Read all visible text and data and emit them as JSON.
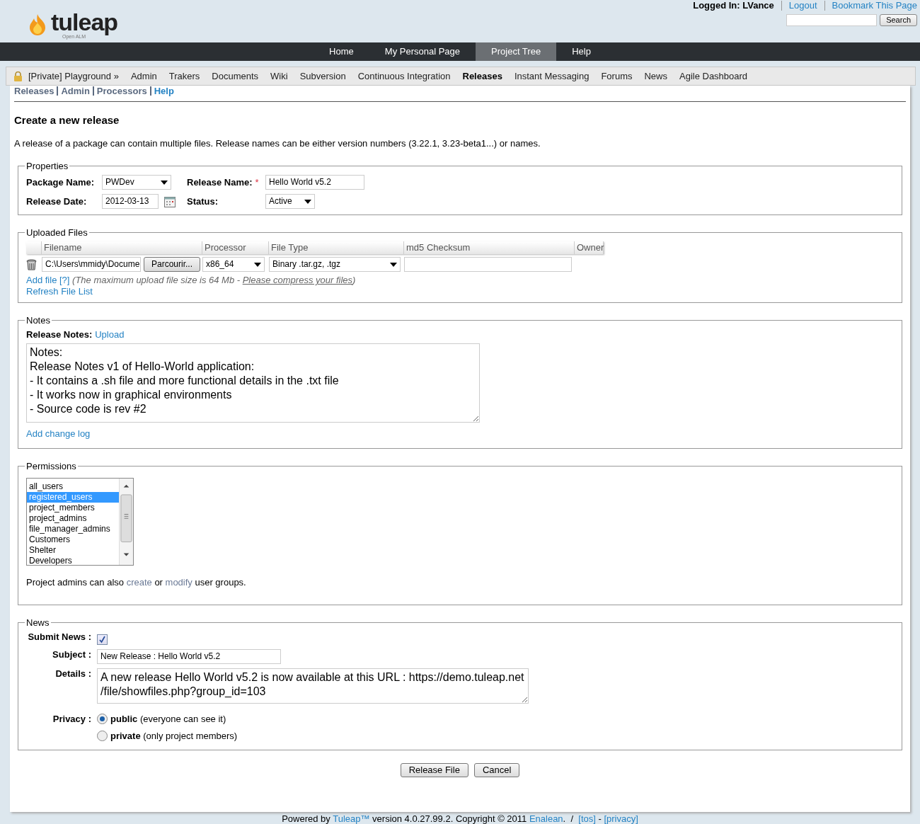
{
  "header": {
    "logo": {
      "name": "tuleap",
      "tagline": "Open ALM"
    },
    "logged_in": "Logged In: LVance",
    "links": [
      "Logout",
      "Bookmark This Page"
    ],
    "search": {
      "button": "Search"
    }
  },
  "main_nav": [
    {
      "label": "Home",
      "selected": false
    },
    {
      "label": "My Personal Page",
      "selected": false
    },
    {
      "label": "Project Tree",
      "selected": true
    },
    {
      "label": "Help",
      "selected": false
    }
  ],
  "project_nav": {
    "project": "[Private] Playground »",
    "items": [
      {
        "label": "Admin",
        "selected": false
      },
      {
        "label": "Trakers",
        "selected": false
      },
      {
        "label": "Documents",
        "selected": false
      },
      {
        "label": "Wiki",
        "selected": false
      },
      {
        "label": "Subversion",
        "selected": false
      },
      {
        "label": "Continuous Integration",
        "selected": false
      },
      {
        "label": "Releases",
        "selected": true
      },
      {
        "label": "Instant Messaging",
        "selected": false
      },
      {
        "label": "Forums",
        "selected": false
      },
      {
        "label": "News",
        "selected": false
      },
      {
        "label": "Agile Dashboard",
        "selected": false
      }
    ]
  },
  "sub_nav": [
    {
      "label": "Releases",
      "selected": false
    },
    {
      "label": "Admin",
      "selected": false
    },
    {
      "label": "Processors",
      "selected": false
    },
    {
      "label": "Help",
      "selected": true
    }
  ],
  "title": "Create a new release",
  "intro": "A release of a package can contain multiple files. Release names can be either version numbers (3.22.1, 3.23-beta1...) or names.",
  "properties": {
    "legend": "Properties",
    "package_name": {
      "label": "Package Name:",
      "value": "PWDev"
    },
    "release_name": {
      "label": "Release Name:",
      "required_mark": "*",
      "value": "Hello World v5.2"
    },
    "release_date": {
      "label": "Release Date:",
      "value": "2012-03-13"
    },
    "status": {
      "label": "Status:",
      "value": "Active"
    }
  },
  "uploaded_files": {
    "legend": "Uploaded Files",
    "columns": [
      "Filename",
      "Processor",
      "File Type",
      "md5 Checksum",
      "Owner"
    ],
    "rows": [
      {
        "filename": "C:\\Users\\mmidy\\Docume",
        "browse": "Parcourir...",
        "processor": "x86_64",
        "file_type": "Binary .tar.gz, .tgz",
        "md5": ""
      }
    ],
    "add_file": "Add file",
    "help": "[?]",
    "limit_note": "(The maximum upload file size is 64 Mb - ",
    "compress_link": "Please compress your files",
    "limit_end": ")",
    "refresh": "Refresh File List"
  },
  "notes": {
    "legend": "Notes",
    "label": "Release Notes:",
    "upload": "Upload",
    "text": "Notes:\nRelease Notes v1 of Hello-World application:\n- It contains a .sh file and more functional details in the .txt file\n- It works now in graphical environments\n- Source code is rev #2",
    "add_change_log": "Add change log"
  },
  "permissions": {
    "legend": "Permissions",
    "groups": [
      {
        "label": "all_users",
        "selected": false
      },
      {
        "label": "registered_users",
        "selected": true
      },
      {
        "label": "project_members",
        "selected": false
      },
      {
        "label": "project_admins",
        "selected": false
      },
      {
        "label": "file_manager_admins",
        "selected": false
      },
      {
        "label": "Customers",
        "selected": false
      },
      {
        "label": "Shelter",
        "selected": false
      },
      {
        "label": "Developers",
        "selected": false
      }
    ],
    "note": [
      {
        "kind": "text",
        "text": "Project admins can also "
      },
      {
        "kind": "link",
        "text": "create"
      },
      {
        "kind": "text",
        "text": " or "
      },
      {
        "kind": "link",
        "text": "modify"
      },
      {
        "kind": "text",
        "text": " user groups."
      }
    ]
  },
  "news": {
    "legend": "News",
    "submit": {
      "label": "Submit News :",
      "checked": true
    },
    "subject": {
      "label": "Subject :",
      "value": "New Release : Hello World v5.2"
    },
    "details": {
      "label": "Details :",
      "value": "A new release Hello World v5.2 is now available at this URL : https://demo.tuleap.net\n/file/showfiles.php?group_id=103"
    },
    "privacy": {
      "label": "Privacy :",
      "options": [
        {
          "label": "public",
          "note": "(everyone can see it)",
          "selected": true
        },
        {
          "label": "private",
          "note": "(only project members)",
          "selected": false
        }
      ]
    }
  },
  "buttons": [
    "Release File",
    "Cancel"
  ],
  "footer": [
    {
      "kind": "text",
      "text": "Powered by "
    },
    {
      "kind": "link",
      "text": "Tuleap™"
    },
    {
      "kind": "text",
      "text": " version 4.0.27.99.2. Copyright © 2011 "
    },
    {
      "kind": "link",
      "text": "Enalean"
    },
    {
      "kind": "text",
      "text": ".  /  "
    },
    {
      "kind": "link",
      "text": "[tos]"
    },
    {
      "kind": "text",
      "text": " - "
    },
    {
      "kind": "link",
      "text": "[privacy]"
    }
  ]
}
